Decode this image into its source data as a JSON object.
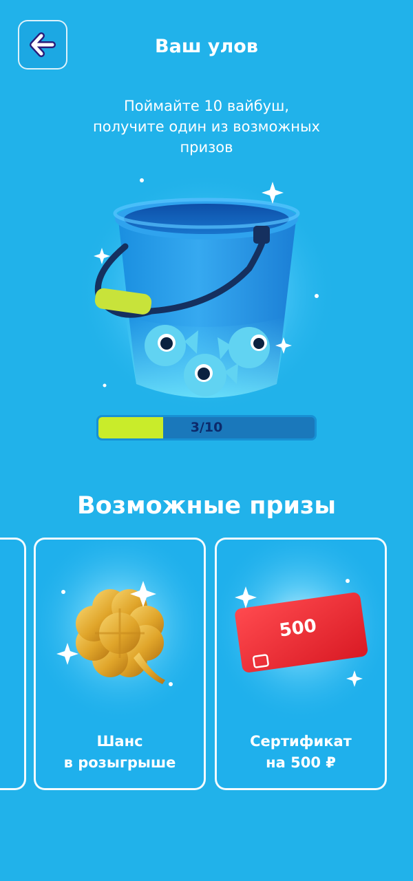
{
  "header": {
    "title": "Ваш улов",
    "back_icon": "arrow-left-icon"
  },
  "intro": {
    "lines": [
      "Поймайте 10 вайбуш,",
      "получите один из возможных",
      "призов"
    ]
  },
  "progress": {
    "text": "3/10",
    "current": 3,
    "total": 10,
    "fill_color": "#c9ec2a"
  },
  "prizes": {
    "heading": "Возможные призы",
    "items": [
      {
        "icon": "golden-clover-icon",
        "label_lines": [
          "Шанс",
          "в розыгрыше"
        ]
      },
      {
        "icon": "gift-card-icon",
        "card_value": "500",
        "label_lines": [
          "Сертификат",
          "на 500 ₽"
        ]
      }
    ]
  },
  "colors": {
    "background": "#21b2ea",
    "card_red": "#e8232e",
    "progress_track": "#1a78bb"
  }
}
